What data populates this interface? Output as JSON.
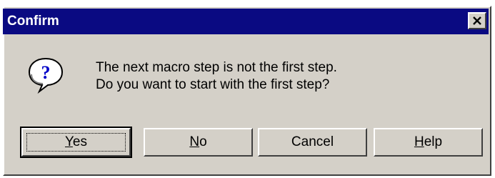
{
  "window": {
    "title": "Confirm"
  },
  "icon": "question-icon",
  "message": {
    "line1": "The next macro step is not the first step.",
    "line2": "Do you want to start with the first step?"
  },
  "buttons": {
    "yes": {
      "mnemonic": "Y",
      "rest": "es"
    },
    "no": {
      "mnemonic": "N",
      "rest": "o"
    },
    "cancel": {
      "label": "Cancel"
    },
    "help": {
      "mnemonic": "H",
      "rest": "elp"
    }
  },
  "colors": {
    "titlebar": "#0a0a82",
    "face": "#d4d0c8",
    "title_text": "#ffffff"
  }
}
